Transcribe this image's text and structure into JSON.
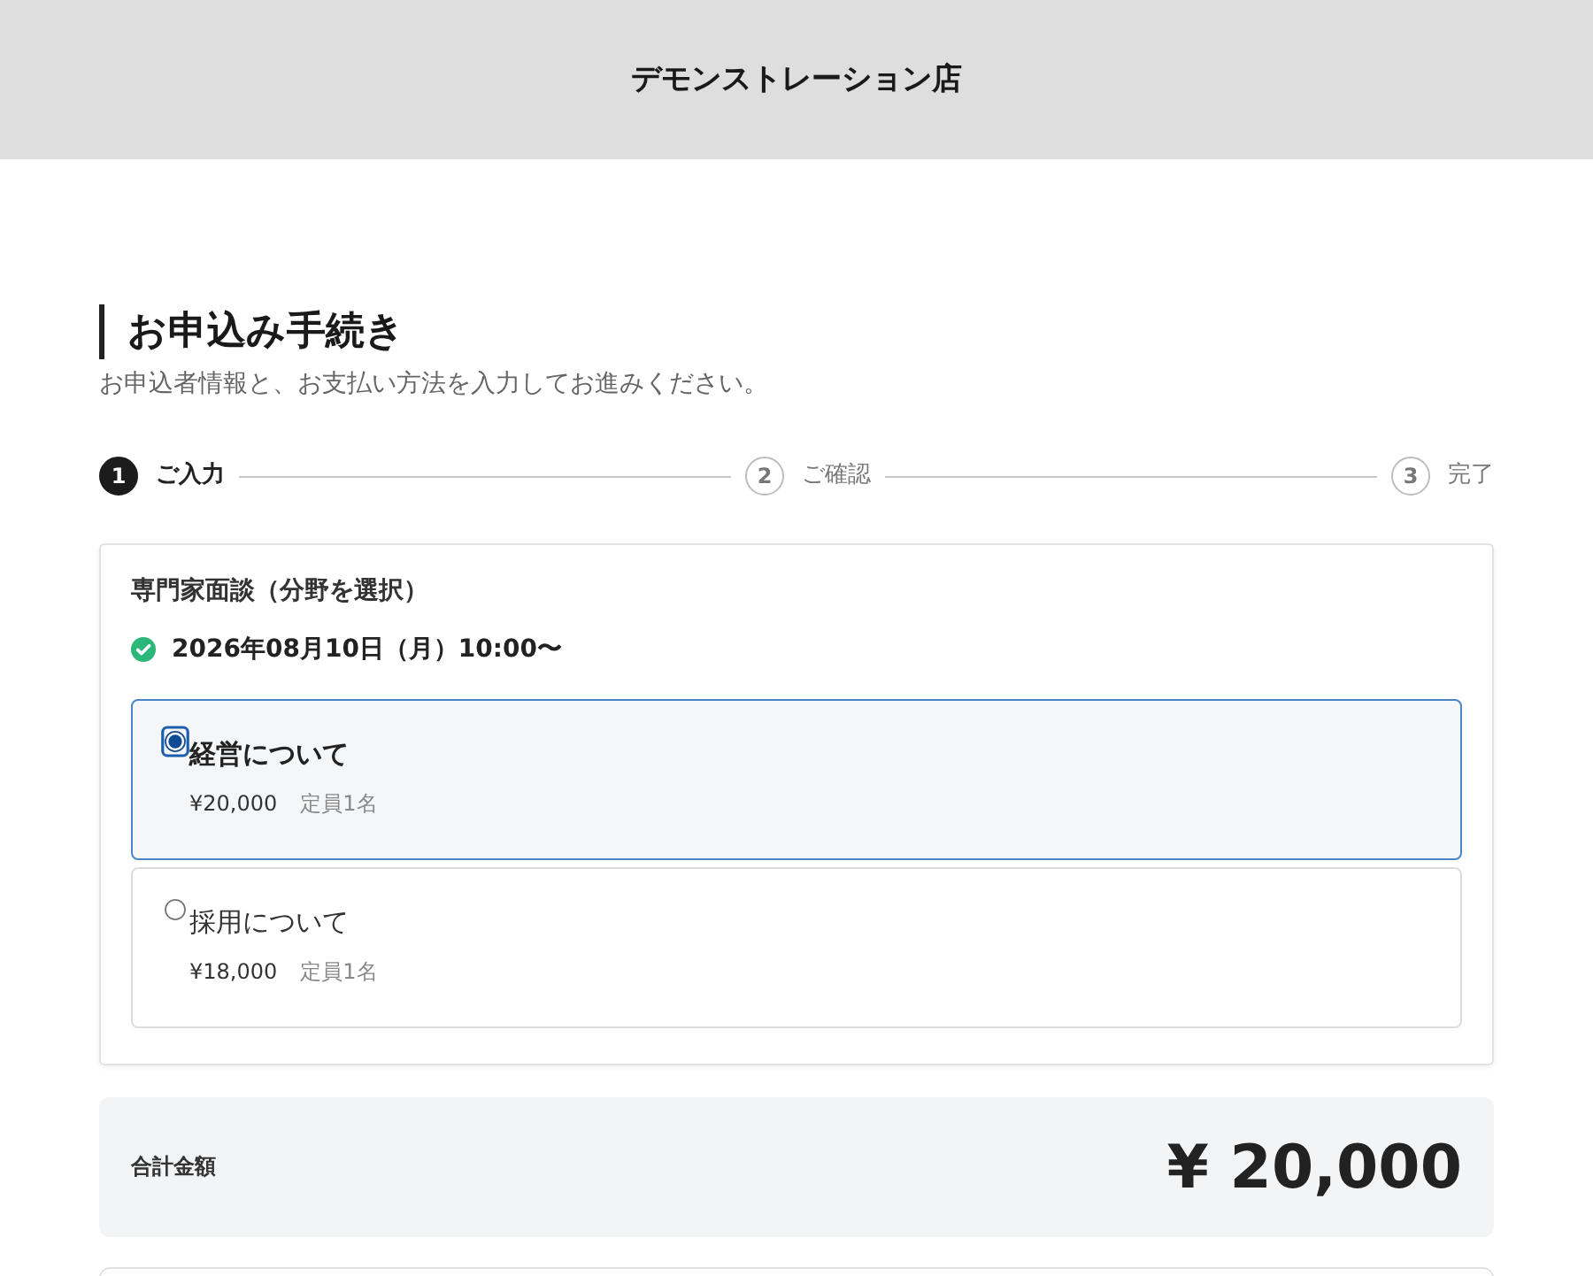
{
  "header": {
    "title": "デモンストレーション店"
  },
  "page": {
    "title": "お申込み手続き",
    "subtitle": "お申込者情報と、お支払い方法を入力してお進みください。"
  },
  "steps": [
    {
      "number": "1",
      "label": "ご入力",
      "selected": true
    },
    {
      "number": "2",
      "label": "ご確認",
      "selected": false
    },
    {
      "number": "3",
      "label": "完了",
      "selected": false
    }
  ],
  "booking": {
    "title": "専門家面談（分野を選択）",
    "date": "2026年08月10日（月）10:00〜",
    "options": [
      {
        "label": "経営について",
        "price": "¥20,000",
        "capacity": "定員1名",
        "selected": true
      },
      {
        "label": "採用について",
        "price": "¥18,000",
        "capacity": "定員1名",
        "selected": false
      }
    ]
  },
  "total": {
    "label": "合計金額",
    "amount": "¥ 20,000"
  }
}
